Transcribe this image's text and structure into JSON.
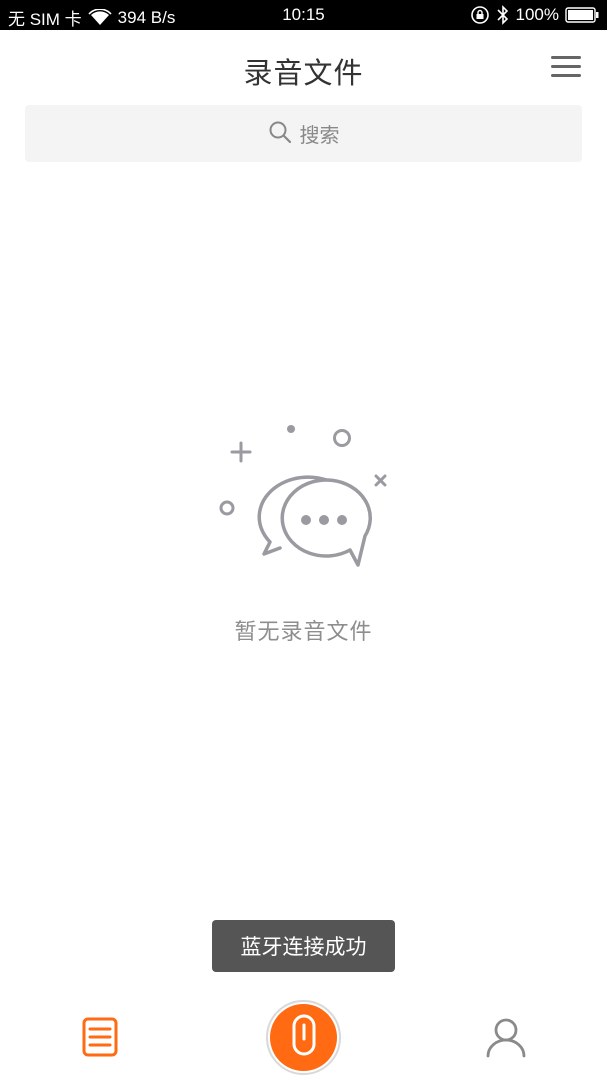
{
  "status_bar": {
    "sim": "无 SIM 卡",
    "network_speed": "394 B/s",
    "time": "10:15",
    "battery": "100%",
    "icons": [
      "wifi-icon",
      "rotation-lock-icon",
      "bluetooth-icon",
      "battery-icon"
    ]
  },
  "header": {
    "title": "录音文件",
    "menu_icon": "hamburger-menu-icon"
  },
  "search": {
    "placeholder": "搜索",
    "icon": "search-icon"
  },
  "empty_state": {
    "message": "暂无录音文件",
    "icon": "chat-bubbles-icon"
  },
  "toast": {
    "message": "蓝牙连接成功"
  },
  "bottom_nav": {
    "items": [
      {
        "icon": "file-list-icon",
        "active": true
      },
      {
        "icon": "microphone-icon"
      },
      {
        "icon": "person-icon",
        "active": false
      }
    ]
  },
  "colors": {
    "accent": "#ff6a12",
    "illustration": "#9a9aa0",
    "toast_bg": "#555555",
    "search_bg": "#f4f4f4"
  }
}
